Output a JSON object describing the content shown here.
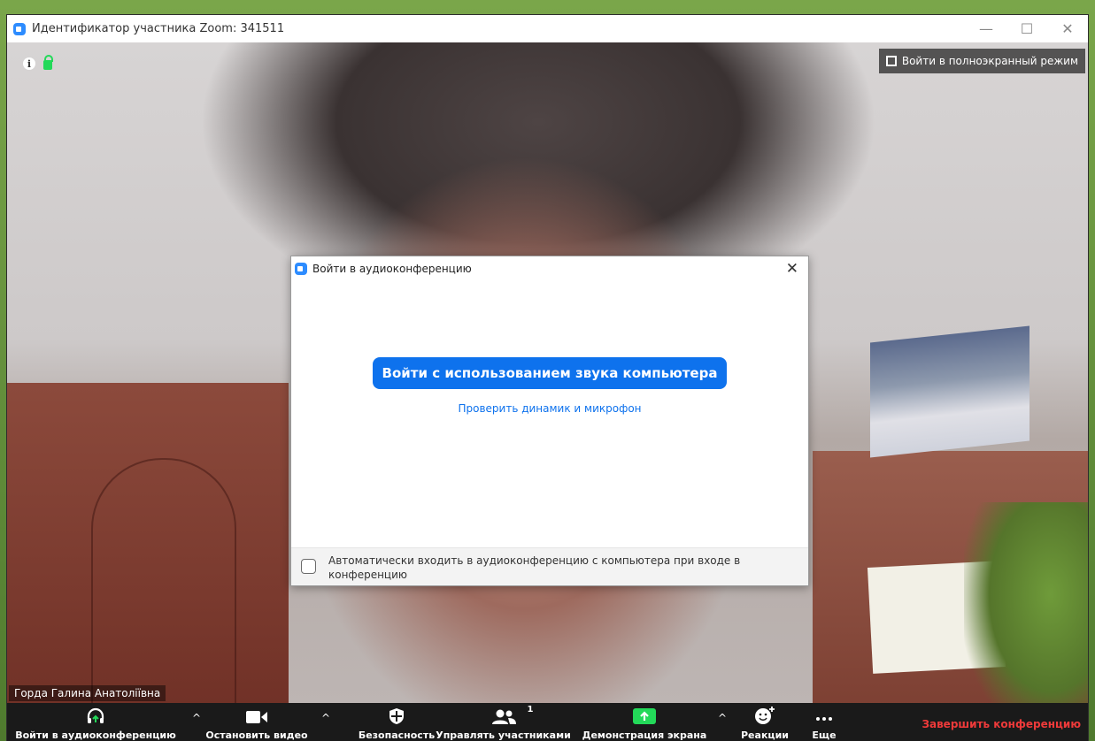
{
  "window": {
    "title": "Идентификатор участника Zoom: 341511",
    "controls": [
      "—",
      "☐",
      "✕"
    ]
  },
  "video": {
    "fullscreen_label": "Войти в полноэкранный режим",
    "participant_name": "Горда Галина Анатоліївна"
  },
  "dialog": {
    "title": "Войти в аудиоконференцию",
    "close": "✕",
    "join_button": "Войти с использованием звука компьютера",
    "test_link": "Проверить динамик и микрофон",
    "auto_join_label": "Автоматически входить в аудиоконференцию с компьютера при входе в конференцию",
    "auto_join_checked": false
  },
  "toolbar": {
    "audio_label": "Войти в аудиоконференцию",
    "video_label": "Остановить видео",
    "security_label": "Безопасность",
    "participants_label": "Управлять участниками",
    "participants_count": "1",
    "share_label": "Демонстрация экрана",
    "reactions_label": "Реакции",
    "more_label": "Еще",
    "end_label": "Завершить конференцию",
    "caret": "^"
  },
  "colors": {
    "accent": "#0e72ed",
    "end": "#ef3a3a",
    "share_green": "#23d959",
    "toolbar_bg": "#1a1a1a"
  }
}
